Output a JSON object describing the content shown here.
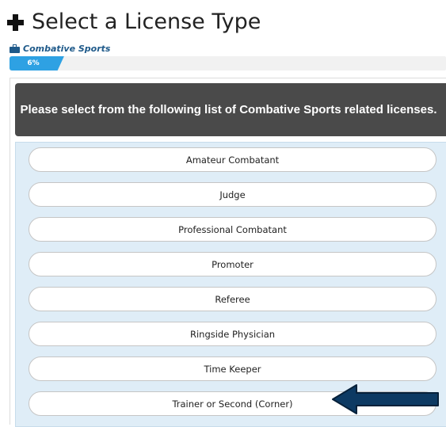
{
  "header": {
    "title": "Select a License Type",
    "add_icon": "plus-icon"
  },
  "category": {
    "icon": "briefcase-icon",
    "label": "Combative Sports"
  },
  "progress": {
    "value_percent": 6,
    "label": "6%",
    "fill_color": "#2ea1e3"
  },
  "instructions": {
    "text": "Please select from the following list of Combative Sports related licenses."
  },
  "licenses": [
    {
      "label": "Amateur Combatant"
    },
    {
      "label": "Judge"
    },
    {
      "label": "Professional Combatant"
    },
    {
      "label": "Promoter"
    },
    {
      "label": "Referee"
    },
    {
      "label": "Ringside Physician"
    },
    {
      "label": "Time Keeper"
    },
    {
      "label": "Trainer or Second (Corner)"
    }
  ],
  "annotation": {
    "icon": "left-arrow-icon",
    "color": "#0d3a63",
    "points_to": "Trainer or Second (Corner)"
  },
  "colors": {
    "instructions_bg": "#4a4a4a",
    "list_bg": "#dfedf7",
    "category_text": "#1f5a8a"
  }
}
